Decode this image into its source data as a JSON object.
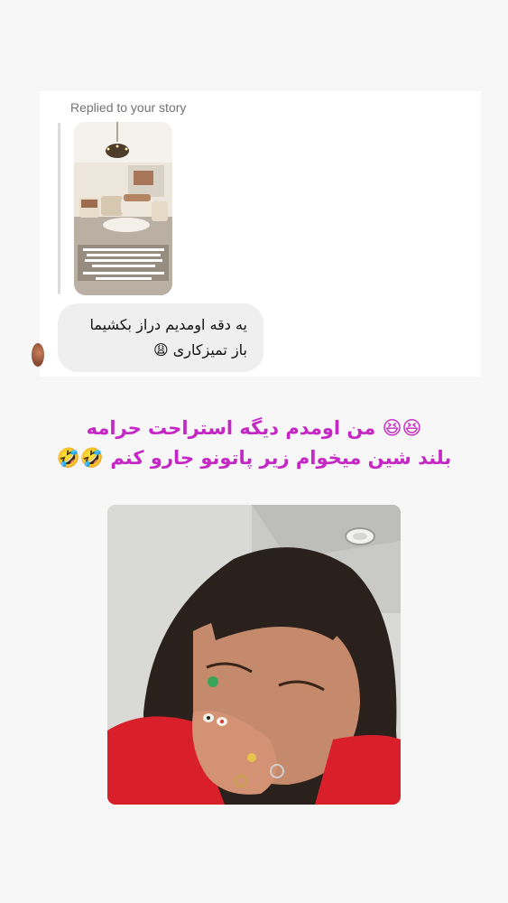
{
  "story_reply": {
    "label": "Replied to your story",
    "message_line_1": "یه دقه اومدیم دراز بکشیما",
    "message_line_2": "باز تمیزکاری 😩"
  },
  "caption": {
    "line_1": "😆😆 من اومدم دیگه استراحت حرامه",
    "line_2": "بلند شین میخوام زیر پاتونو جارو کنم 🤣🤣",
    "color": "#c427c4"
  },
  "colors": {
    "background": "#f7f7f7",
    "card": "#ffffff",
    "bubble": "#efefef",
    "label_text": "#737373"
  },
  "icons": [
    "weary-face-emoji",
    "laughing-emoji",
    "rofl-emoji"
  ]
}
